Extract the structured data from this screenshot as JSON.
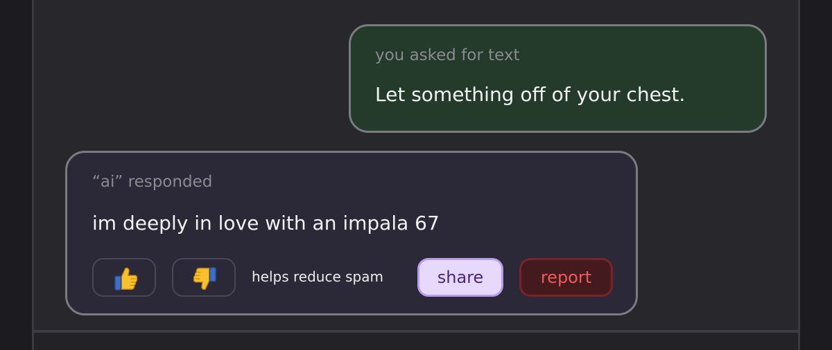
{
  "conversation": {
    "user_message": {
      "caption": "you asked for text",
      "text": "Let something off of your chest."
    },
    "ai_message": {
      "caption": "“ai” responded",
      "text": "im deeply in love with an impala 67"
    }
  },
  "actions": {
    "thumbs_up_icon": "thumbs-up-icon",
    "thumbs_down_icon": "thumbs-down-icon",
    "spam_note": "helps reduce spam",
    "share_label": "share",
    "report_label": "report"
  },
  "colors": {
    "user_bubble": "#243b2c",
    "ai_bubble": "#2b2837",
    "share_bg": "#e6d9fb",
    "share_text": "#4b2488",
    "report_bg": "#451a1e",
    "report_text": "#ef5a5a"
  }
}
